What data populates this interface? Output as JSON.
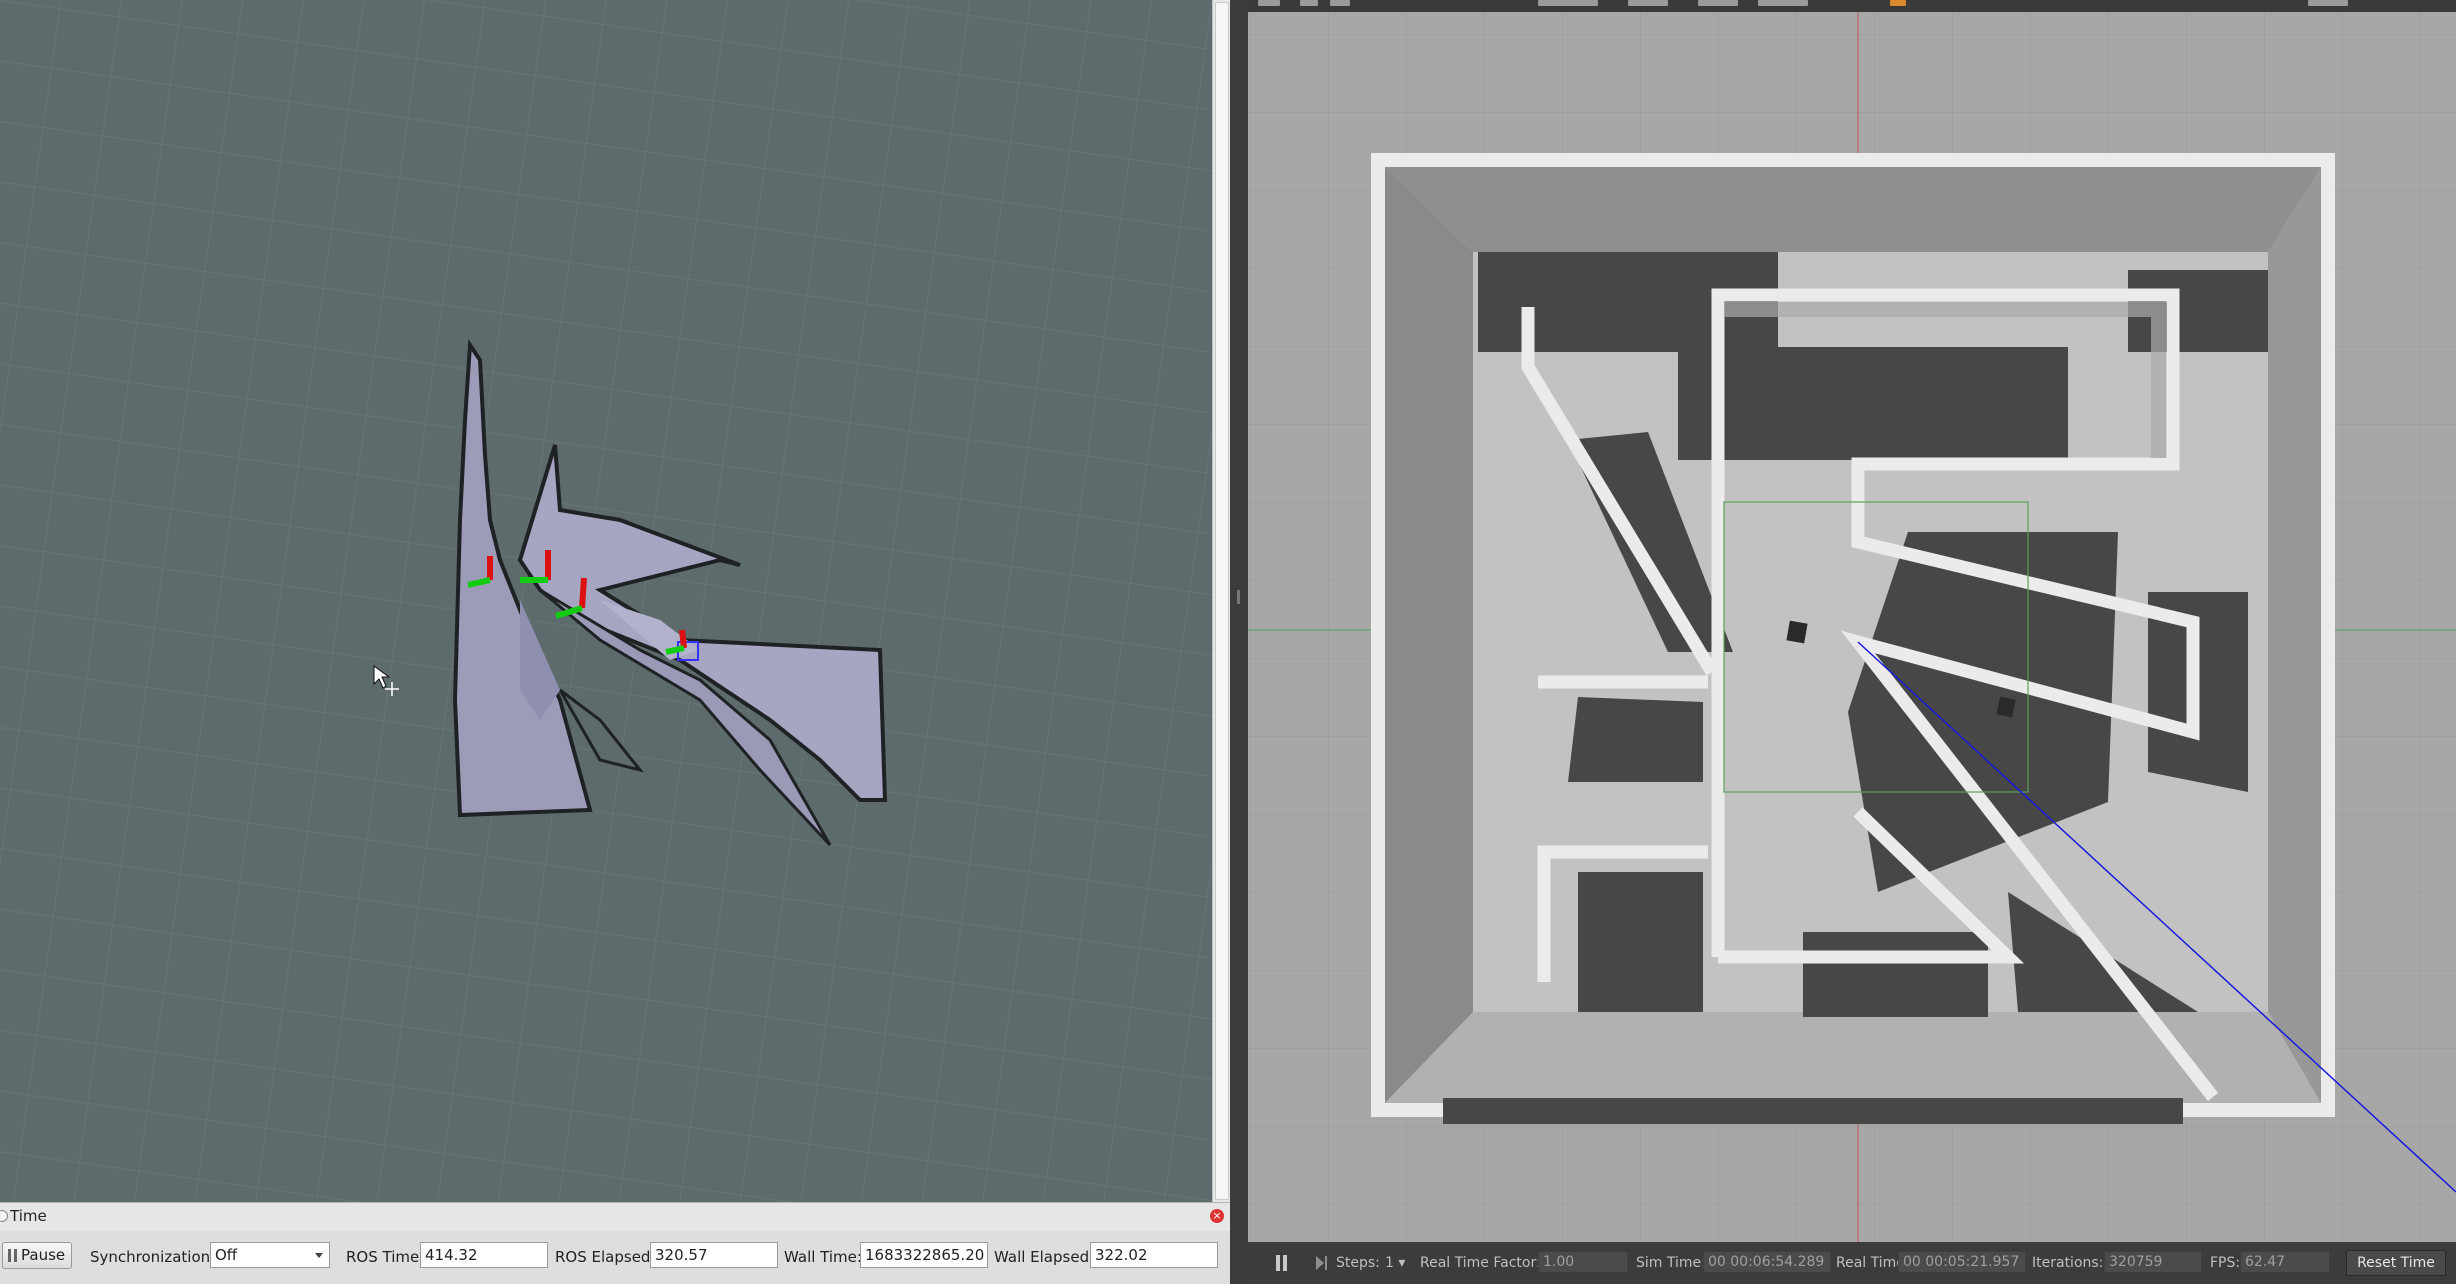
{
  "time_panel": {
    "title": "Time",
    "pause_label": "Pause",
    "sync_label": "Synchronization:",
    "sync_value": "Off",
    "ros_time_label": "ROS Time:",
    "ros_time_value": "414.32",
    "ros_elapsed_label": "ROS Elapsed:",
    "ros_elapsed_value": "320.57",
    "wall_time_label": "Wall Time:",
    "wall_time_value": "1683322865.20",
    "wall_elapsed_label": "Wall Elapsed:",
    "wall_elapsed_value": "322.02"
  },
  "gazebo_bar": {
    "steps_label": "Steps:",
    "steps_value": "1",
    "rtf_label": "Real Time Factor:",
    "rtf_value": "1.00",
    "sim_time_label": "Sim Time:",
    "sim_time_value": "00 00:06:54.289",
    "real_time_label": "Real Time:",
    "real_time_value": "00 00:05:21.957",
    "iterations_label": "Iterations:",
    "iterations_value": "320759",
    "fps_label": "FPS:",
    "fps_value": "62.47",
    "reset_label": "Reset Time"
  },
  "colors": {
    "rviz_background": "#5d6b6d",
    "map_free": "#a8a8c0",
    "gazebo_background": "#a7a7a7",
    "wall": "#ebebeb",
    "shadow": "#474747",
    "laser_ray": "#1a1adc"
  }
}
